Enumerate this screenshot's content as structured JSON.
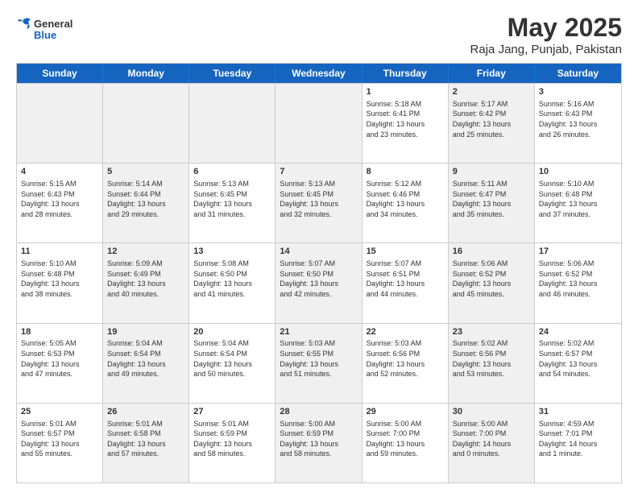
{
  "header": {
    "logo_general": "General",
    "logo_blue": "Blue",
    "title": "May 2025",
    "subtitle": "Raja Jang, Punjab, Pakistan"
  },
  "days_of_week": [
    "Sunday",
    "Monday",
    "Tuesday",
    "Wednesday",
    "Thursday",
    "Friday",
    "Saturday"
  ],
  "weeks": [
    [
      {
        "day": "",
        "text": "",
        "shaded": true
      },
      {
        "day": "",
        "text": "",
        "shaded": true
      },
      {
        "day": "",
        "text": "",
        "shaded": true
      },
      {
        "day": "",
        "text": "",
        "shaded": true
      },
      {
        "day": "1",
        "text": "Sunrise: 5:18 AM\nSunset: 6:41 PM\nDaylight: 13 hours\nand 23 minutes.",
        "shaded": false
      },
      {
        "day": "2",
        "text": "Sunrise: 5:17 AM\nSunset: 6:42 PM\nDaylight: 13 hours\nand 25 minutes.",
        "shaded": true
      },
      {
        "day": "3",
        "text": "Sunrise: 5:16 AM\nSunset: 6:43 PM\nDaylight: 13 hours\nand 26 minutes.",
        "shaded": false
      }
    ],
    [
      {
        "day": "4",
        "text": "Sunrise: 5:15 AM\nSunset: 6:43 PM\nDaylight: 13 hours\nand 28 minutes.",
        "shaded": false
      },
      {
        "day": "5",
        "text": "Sunrise: 5:14 AM\nSunset: 6:44 PM\nDaylight: 13 hours\nand 29 minutes.",
        "shaded": true
      },
      {
        "day": "6",
        "text": "Sunrise: 5:13 AM\nSunset: 6:45 PM\nDaylight: 13 hours\nand 31 minutes.",
        "shaded": false
      },
      {
        "day": "7",
        "text": "Sunrise: 5:13 AM\nSunset: 6:45 PM\nDaylight: 13 hours\nand 32 minutes.",
        "shaded": true
      },
      {
        "day": "8",
        "text": "Sunrise: 5:12 AM\nSunset: 6:46 PM\nDaylight: 13 hours\nand 34 minutes.",
        "shaded": false
      },
      {
        "day": "9",
        "text": "Sunrise: 5:11 AM\nSunset: 6:47 PM\nDaylight: 13 hours\nand 35 minutes.",
        "shaded": true
      },
      {
        "day": "10",
        "text": "Sunrise: 5:10 AM\nSunset: 6:48 PM\nDaylight: 13 hours\nand 37 minutes.",
        "shaded": false
      }
    ],
    [
      {
        "day": "11",
        "text": "Sunrise: 5:10 AM\nSunset: 6:48 PM\nDaylight: 13 hours\nand 38 minutes.",
        "shaded": false
      },
      {
        "day": "12",
        "text": "Sunrise: 5:09 AM\nSunset: 6:49 PM\nDaylight: 13 hours\nand 40 minutes.",
        "shaded": true
      },
      {
        "day": "13",
        "text": "Sunrise: 5:08 AM\nSunset: 6:50 PM\nDaylight: 13 hours\nand 41 minutes.",
        "shaded": false
      },
      {
        "day": "14",
        "text": "Sunrise: 5:07 AM\nSunset: 6:50 PM\nDaylight: 13 hours\nand 42 minutes.",
        "shaded": true
      },
      {
        "day": "15",
        "text": "Sunrise: 5:07 AM\nSunset: 6:51 PM\nDaylight: 13 hours\nand 44 minutes.",
        "shaded": false
      },
      {
        "day": "16",
        "text": "Sunrise: 5:06 AM\nSunset: 6:52 PM\nDaylight: 13 hours\nand 45 minutes.",
        "shaded": true
      },
      {
        "day": "17",
        "text": "Sunrise: 5:06 AM\nSunset: 6:52 PM\nDaylight: 13 hours\nand 46 minutes.",
        "shaded": false
      }
    ],
    [
      {
        "day": "18",
        "text": "Sunrise: 5:05 AM\nSunset: 6:53 PM\nDaylight: 13 hours\nand 47 minutes.",
        "shaded": false
      },
      {
        "day": "19",
        "text": "Sunrise: 5:04 AM\nSunset: 6:54 PM\nDaylight: 13 hours\nand 49 minutes.",
        "shaded": true
      },
      {
        "day": "20",
        "text": "Sunrise: 5:04 AM\nSunset: 6:54 PM\nDaylight: 13 hours\nand 50 minutes.",
        "shaded": false
      },
      {
        "day": "21",
        "text": "Sunrise: 5:03 AM\nSunset: 6:55 PM\nDaylight: 13 hours\nand 51 minutes.",
        "shaded": true
      },
      {
        "day": "22",
        "text": "Sunrise: 5:03 AM\nSunset: 6:56 PM\nDaylight: 13 hours\nand 52 minutes.",
        "shaded": false
      },
      {
        "day": "23",
        "text": "Sunrise: 5:02 AM\nSunset: 6:56 PM\nDaylight: 13 hours\nand 53 minutes.",
        "shaded": true
      },
      {
        "day": "24",
        "text": "Sunrise: 5:02 AM\nSunset: 6:57 PM\nDaylight: 13 hours\nand 54 minutes.",
        "shaded": false
      }
    ],
    [
      {
        "day": "25",
        "text": "Sunrise: 5:01 AM\nSunset: 6:57 PM\nDaylight: 13 hours\nand 55 minutes.",
        "shaded": false
      },
      {
        "day": "26",
        "text": "Sunrise: 5:01 AM\nSunset: 6:58 PM\nDaylight: 13 hours\nand 57 minutes.",
        "shaded": true
      },
      {
        "day": "27",
        "text": "Sunrise: 5:01 AM\nSunset: 6:59 PM\nDaylight: 13 hours\nand 58 minutes.",
        "shaded": false
      },
      {
        "day": "28",
        "text": "Sunrise: 5:00 AM\nSunset: 6:59 PM\nDaylight: 13 hours\nand 58 minutes.",
        "shaded": true
      },
      {
        "day": "29",
        "text": "Sunrise: 5:00 AM\nSunset: 7:00 PM\nDaylight: 13 hours\nand 59 minutes.",
        "shaded": false
      },
      {
        "day": "30",
        "text": "Sunrise: 5:00 AM\nSunset: 7:00 PM\nDaylight: 14 hours\nand 0 minutes.",
        "shaded": true
      },
      {
        "day": "31",
        "text": "Sunrise: 4:59 AM\nSunset: 7:01 PM\nDaylight: 14 hours\nand 1 minute.",
        "shaded": false
      }
    ]
  ]
}
